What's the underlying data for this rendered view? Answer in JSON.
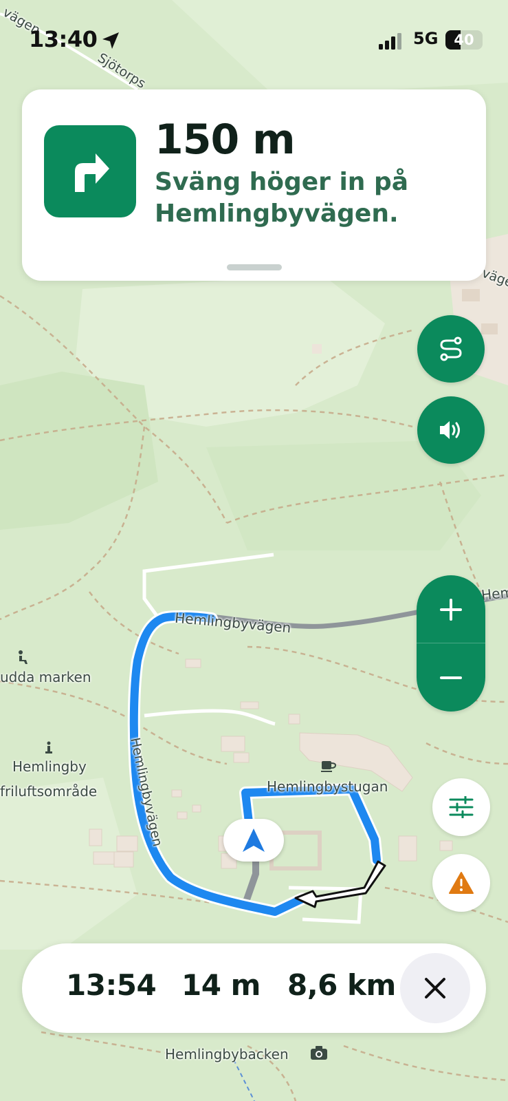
{
  "status_bar": {
    "time": "13:40",
    "network": "5G",
    "battery": "40",
    "battery_level": 0.4
  },
  "instruction": {
    "distance": "150 m",
    "text": "Sväng höger in på Hemlingbyvägen.",
    "icon": "turn-right-arrow-icon"
  },
  "controls": {
    "route_overview_icon": "route-icon",
    "sound_icon": "speaker-icon",
    "zoom_in_icon": "plus-icon",
    "zoom_out_icon": "minus-icon",
    "settings_icon": "sliders-icon",
    "report_icon": "warning-icon"
  },
  "map_labels": {
    "road_top_left": "Sjötorps",
    "road_top_left_edge": "vägen",
    "road_right_edge": "vägen",
    "road_main": "Hemlingbyvägen",
    "road_main_right": "Hemli",
    "road_west": "Hemlingbyvägen",
    "area_udda": "udda marken",
    "area_friluft_line1": "Hemlingby",
    "area_friluft_line2": "friluftsområde",
    "poi_stugan": "Hemlingbystugan",
    "poi_backen": "Hemlingbybacken"
  },
  "trip": {
    "arrival_time": "13:54",
    "remaining_time": "14 m",
    "remaining_distance": "8,6 km",
    "close_icon": "close-icon"
  },
  "colors": {
    "brand_green": "#0b8a5c",
    "route_blue": "#1e88f0",
    "warning_orange": "#e07a12",
    "map_green": "#d9ebcc"
  }
}
